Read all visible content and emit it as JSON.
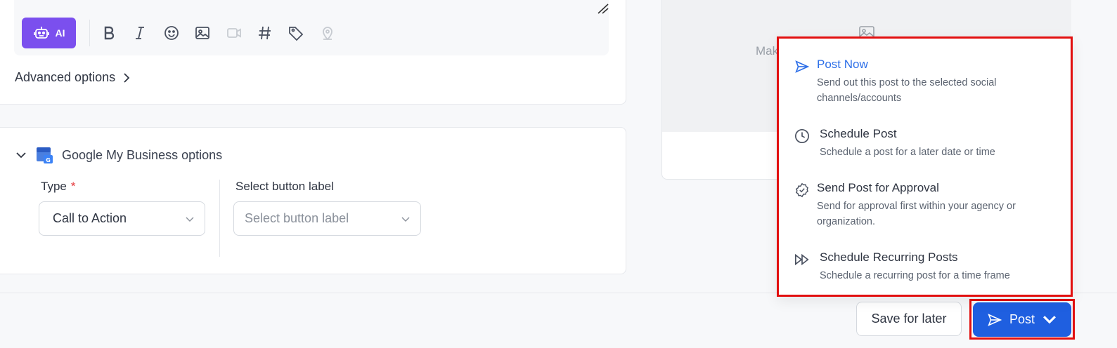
{
  "toolbar": {
    "ai_label": "AI",
    "icons": [
      "bold-icon",
      "italic-icon",
      "emoji-icon",
      "image-icon",
      "video-icon",
      "hashtag-icon",
      "tag-icon",
      "location-icon"
    ]
  },
  "advanced_options": {
    "label": "Advanced options"
  },
  "gmb": {
    "title": "Google My Business options",
    "type_label": "Type",
    "required_mark": "*",
    "type_value": "Call to Action",
    "button_label_label": "Select button label",
    "button_label_placeholder": "Select button label"
  },
  "preview": {
    "text": "Mak"
  },
  "footer": {
    "save_label": "Save for later",
    "post_label": "Post"
  },
  "menu": {
    "items": [
      {
        "title": "Post Now",
        "desc": "Send out this post to the selected social channels/accounts",
        "icon": "send-icon"
      },
      {
        "title": "Schedule Post",
        "desc": "Schedule a post for a later date or time",
        "icon": "clock-icon"
      },
      {
        "title": "Send Post for Approval",
        "desc": "Send for approval first within your agency or organization.",
        "icon": "badge-check-icon"
      },
      {
        "title": "Schedule Recurring Posts",
        "desc": "Schedule a recurring post for a time frame",
        "icon": "fast-forward-icon"
      }
    ]
  },
  "colors": {
    "accent": "#1f5fe0",
    "ai_purple": "#7b4fee",
    "highlight_red": "#e20f0f",
    "active_blue": "#2d6fe8"
  }
}
